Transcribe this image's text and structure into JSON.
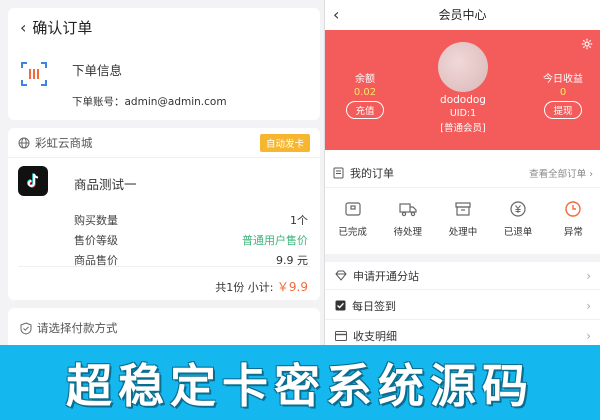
{
  "checkout": {
    "back_icon": "chevron-left-icon",
    "title": "确认订单",
    "order_info": {
      "label": "下单信息",
      "account": "下单账号：admin@admin.com"
    },
    "shop": {
      "name": "彩虹云商城",
      "badge": "自动发卡",
      "badge_color": "#f7b62f"
    },
    "product": {
      "name": "商品测试一",
      "rows": [
        {
          "label": "购买数量",
          "value": "1个"
        },
        {
          "label": "售价等级",
          "value": "普通用户售价"
        },
        {
          "label": "商品售价",
          "value": "9.9 元"
        }
      ],
      "total_prefix": "共1份 小计: ",
      "total_price": "￥9.9"
    },
    "payment": {
      "label": "请选择付款方式"
    }
  },
  "member": {
    "title": "会员中心",
    "banner_color": "#f45b5b",
    "balance": {
      "label": "余额",
      "value": "0.02",
      "button": "充值"
    },
    "today": {
      "label": "今日收益",
      "value": "0",
      "button": "提现"
    },
    "user": {
      "name": "dododog",
      "uid": "UID:1",
      "level": "[普通会员]"
    },
    "orders": {
      "title": "我的订单",
      "more": "查看全部订单 ›",
      "items": [
        {
          "label": "已完成",
          "icon": "completed-icon"
        },
        {
          "label": "待处理",
          "icon": "truck-icon"
        },
        {
          "label": "处理中",
          "icon": "box-icon"
        },
        {
          "label": "已退单",
          "icon": "refund-icon"
        },
        {
          "label": "异常",
          "icon": "clock-icon"
        }
      ]
    },
    "menu": [
      {
        "label": "申请开通分站",
        "icon": "diamond-icon"
      },
      {
        "label": "每日签到",
        "icon": "checkbox-icon"
      },
      {
        "label": "收支明细",
        "icon": "card-icon"
      }
    ]
  },
  "banner": {
    "slogan": "超稳定卡密系统源码",
    "color": "#14b7ee"
  }
}
